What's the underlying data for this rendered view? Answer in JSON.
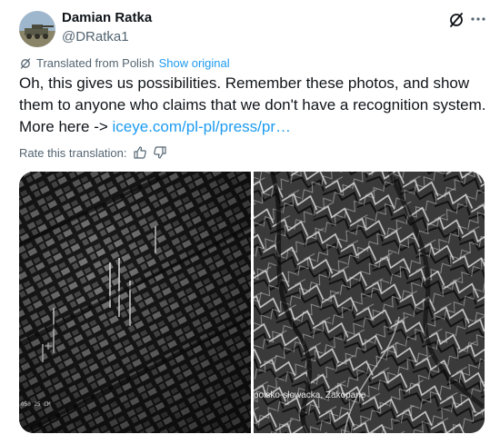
{
  "author": {
    "name": "Damian Ratka",
    "handle": "@DRatka1",
    "avatar_icon": "avatar-photo"
  },
  "header_icons": [
    "grok-icon",
    "more-options-icon"
  ],
  "translation": {
    "label": "Translated from Polish",
    "show_original": "Show original",
    "icon": "translate-icon"
  },
  "tweet": {
    "text": "Oh, this gives us possibilities. Remember these photos, and show them to anyone who claims that we don't have a recognition system. More here -> ",
    "link_text": "iceye.com/pl-pl/press/pr…"
  },
  "rating": {
    "label": "Rate this translation:",
    "icons": [
      "thumbs-up-icon",
      "thumbs-down-icon"
    ]
  },
  "media": {
    "caption": "polsko-słowacka, Zakopane",
    "scale_text": "050 25 CM"
  },
  "colors": {
    "accent": "#1d9bf0",
    "text": "#0f1419",
    "secondary": "#536471"
  }
}
